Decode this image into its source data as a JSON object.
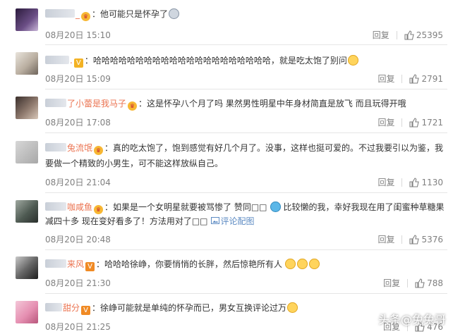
{
  "comments": [
    {
      "name_tail": "_",
      "text": "：他可能只是怀孕了",
      "time": "08月20日 15:10",
      "reply": "回复",
      "likes": "25395"
    },
    {
      "name_tail": "",
      "text": "哈哈哈哈哈哈哈哈哈哈哈哈哈哈哈哈哈哈哈哈哈，就是吃太饱了别问",
      "time": "08月20日 15:09",
      "reply": "回复",
      "likes": "2791"
    },
    {
      "name_tail": "了小蕾是我马子",
      "text": "：这是怀孕八个月了吗 果然男性明星中年身材简直是放飞 而且玩得开哦",
      "time": "08月20日 17:08",
      "reply": "回复",
      "likes": "1721"
    },
    {
      "name_tail": "兔流氓",
      "text": "：真的吃太饱了，饱到感觉有好几个月了。没事，这样也挺可爱的。不过我要引以为鉴，我要做一个精致的小男生，可不能这样放纵自己。",
      "time": "08月20日 21:04",
      "reply": "回复",
      "likes": "1130"
    },
    {
      "name_tail": "咖咸鱼",
      "text_a": "：如果是一个女明星就要被骂惨了 赞同□□",
      "text_b": "比较懒的我，幸好我现在用了闺蜜种草糖果",
      "text_c": "减四十多 现在变好看多了！方法用对了□□",
      "link": "评论配图",
      "time": "08月20日 20:48",
      "reply": "回复",
      "likes": "5376"
    },
    {
      "name_tail": "来风",
      "text": "：哈哈哈徐峥，你要悄悄的长胖，然后惊艳所有人",
      "time": "08月20日 21:30",
      "reply": "回复",
      "likes": "788"
    },
    {
      "name_tail": "甜分",
      "text": "：徐峥可能就是单纯的怀孕而已，男女互换评论过万",
      "time": "08月20日 21:25",
      "reply": "回复",
      "likes": "476"
    }
  ],
  "watermark": "头条@兔兔哥",
  "colors": {
    "username": "#eb7350",
    "link": "#5d8bc3",
    "meta": "#808080"
  }
}
